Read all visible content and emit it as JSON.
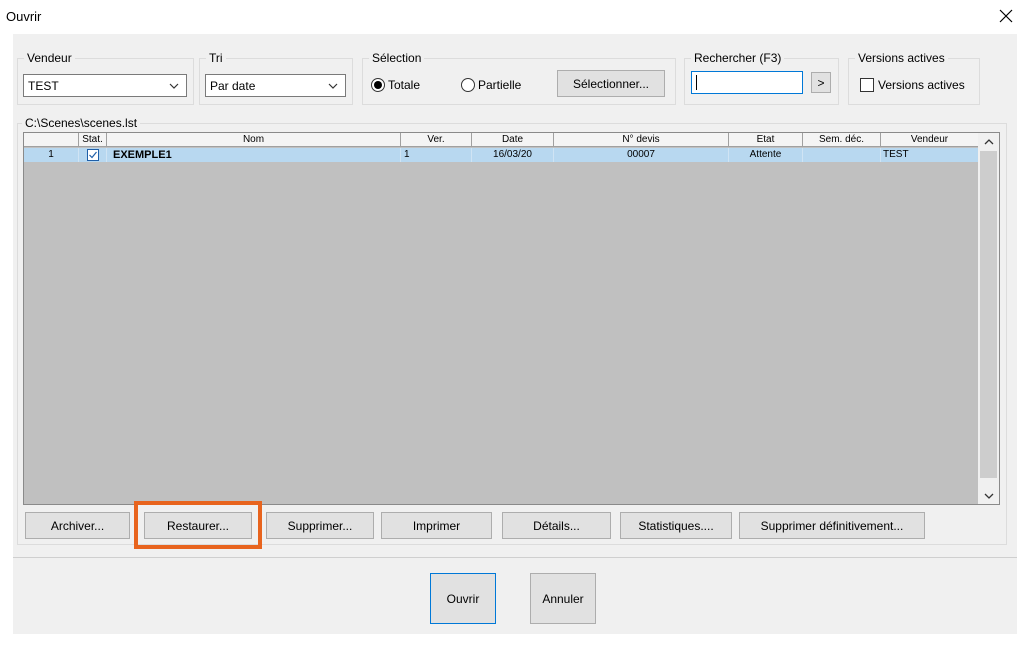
{
  "window": {
    "title": "Ouvrir"
  },
  "vendeur": {
    "label": "Vendeur",
    "value": "TEST"
  },
  "tri": {
    "label": "Tri",
    "value": "Par date"
  },
  "selection": {
    "label": "Sélection",
    "option_totale": "Totale",
    "option_partielle": "Partielle",
    "selected": "Totale",
    "button": "Sélectionner..."
  },
  "search": {
    "label": "Rechercher (F3)",
    "value": "",
    "go_button": ">"
  },
  "versions": {
    "label": "Versions actives",
    "checkbox_label": "Versions actives",
    "checked": false
  },
  "file": {
    "path": "C:\\Scenes\\scenes.lst"
  },
  "table": {
    "columns": [
      "",
      "Stat.",
      "Nom",
      "Ver.",
      "Date",
      "N° devis",
      "Etat",
      "Sem. déc.",
      "Vendeur"
    ],
    "rows": [
      {
        "index": "1",
        "stat_checked": true,
        "nom": "EXEMPLE1",
        "ver": "1",
        "date": "16/03/20",
        "devis": "00007",
        "etat": "Attente",
        "sem": "",
        "vendeur": "TEST"
      }
    ]
  },
  "actions": {
    "archiver": "Archiver...",
    "restaurer": "Restaurer...",
    "supprimer": "Supprimer...",
    "imprimer": "Imprimer",
    "details": "Détails...",
    "statistiques": "Statistiques....",
    "supprimer_def": "Supprimer définitivement..."
  },
  "footer": {
    "ok": "Ouvrir",
    "cancel": "Annuler"
  },
  "colors": {
    "accent": "#0078d7",
    "highlight": "#e8641e",
    "row_selected": "#b8d8f0"
  }
}
